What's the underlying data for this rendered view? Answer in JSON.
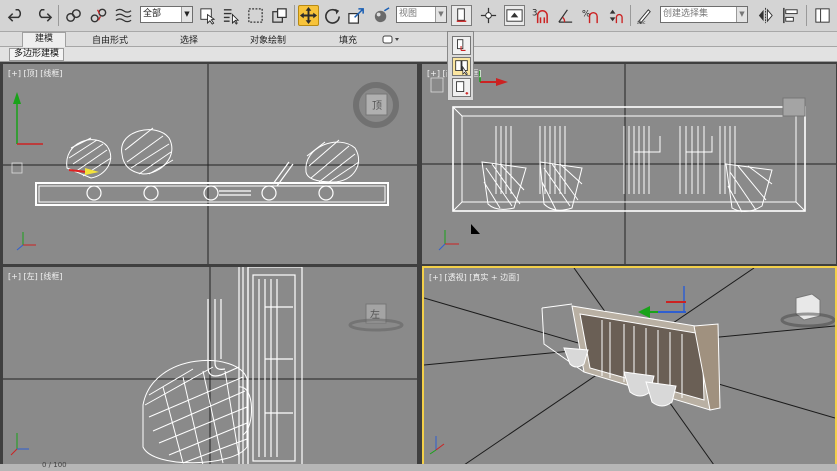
{
  "toolbar": {
    "selection_filter": "全部",
    "reference_coord": "视图",
    "named_selection": "创建选择集",
    "snap_angle_label": "3",
    "icons": [
      "undo-icon",
      "redo-icon",
      "link-icon",
      "unlink-icon",
      "bind-space-warp-icon",
      "select-object-icon",
      "select-by-name-icon",
      "rect-region-icon",
      "window-crossing-icon",
      "select-move-icon",
      "select-rotate-icon",
      "select-scale-icon",
      "use-pivot-icon",
      "pivot-center-icon",
      "manipulate-icon",
      "keyboard-shortcut-icon",
      "snaps-toggle-icon",
      "angle-snap-icon",
      "percent-snap-icon",
      "spinner-snap-icon",
      "edit-named-selection-icon",
      "mirror-icon",
      "align-icon"
    ]
  },
  "ribbon": {
    "tabs": [
      "建模",
      "自由形式",
      "选择",
      "对象绘制",
      "填充"
    ],
    "active_tab": "建模",
    "sub_tab": "多边形建模"
  },
  "viewports": {
    "top": "[+] [顶] [线框]",
    "front": "[+] [前] [线框]",
    "left": "[+] [左] [线框]",
    "perspective": "[+] [透视] [真实 + 边面]"
  },
  "viewcube": {
    "top_face": "顶",
    "left_face": "左"
  },
  "timeline": {
    "frame": "0 / 100"
  },
  "colors": {
    "active_tool": "#f7c33a",
    "viewport_bg": "#8a8a8a",
    "wireframe": "#ffffff",
    "selected_border": "#f3d04a"
  }
}
